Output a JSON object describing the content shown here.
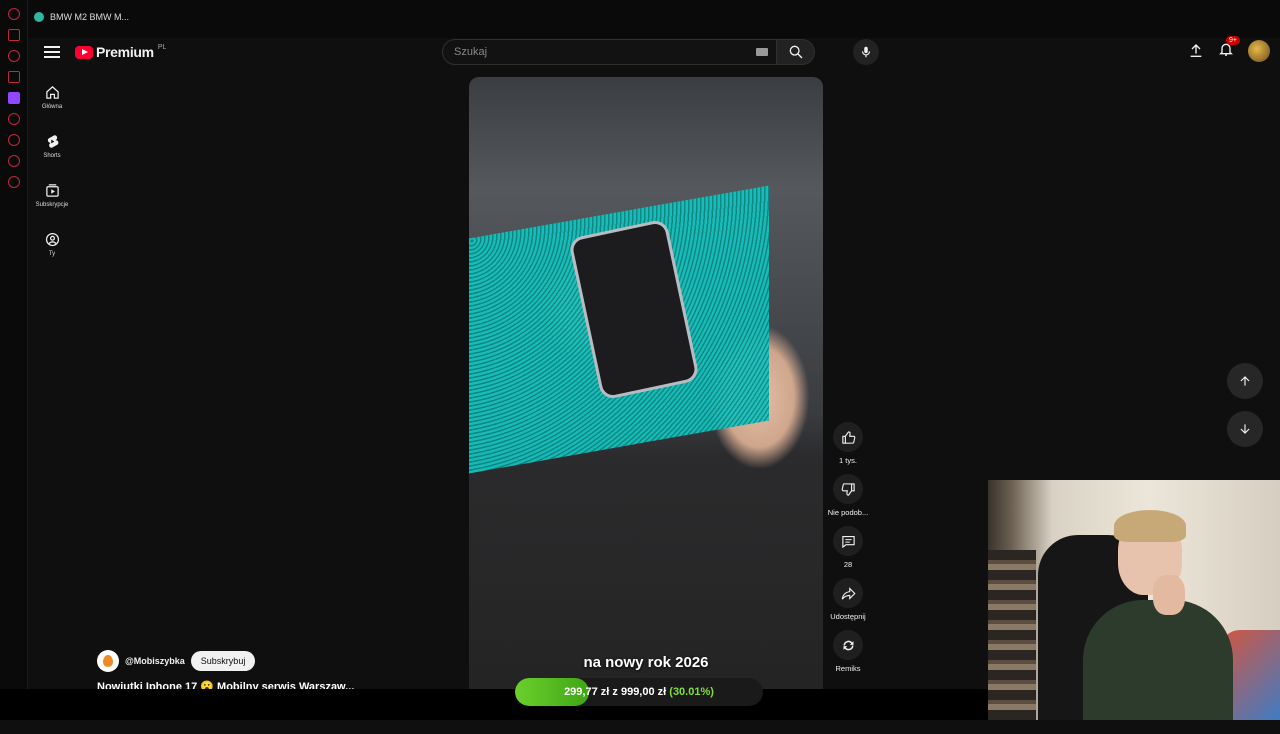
{
  "tab": {
    "title": "BMW M2 BMW M..."
  },
  "header": {
    "logo_text": "Premium",
    "logo_region": "PL",
    "search_placeholder": "Szukaj",
    "notifications_badge": "9+"
  },
  "sidebar": {
    "items": [
      {
        "label": "Główna",
        "icon": "home-icon"
      },
      {
        "label": "Shorts",
        "icon": "shorts-icon"
      },
      {
        "label": "Subskrypcje",
        "icon": "subscriptions-icon"
      },
      {
        "label": "Ty",
        "icon": "you-icon"
      }
    ]
  },
  "video": {
    "caption": "na nowy rok 2026"
  },
  "actions": {
    "like_count": "1 tys.",
    "dislike_label": "Nie podob...",
    "comments_count": "28",
    "share_label": "Udostępnij",
    "remix_label": "Remiks"
  },
  "channel": {
    "handle": "@Mobiszybka",
    "subscribe_label": "Subskrybuj",
    "title": "Nowiutki Iphone 17 😮 Mobilny serwis Warszaw..."
  },
  "donation": {
    "raised": "299,77 zł",
    "separator": "z",
    "goal": "999,00 zł",
    "percent_text": "(30.01%)",
    "progress": 0.3001
  },
  "colors": {
    "accent_red": "#ff0033",
    "progress_green": "#6bd02c",
    "background": "#0f0f0f"
  }
}
